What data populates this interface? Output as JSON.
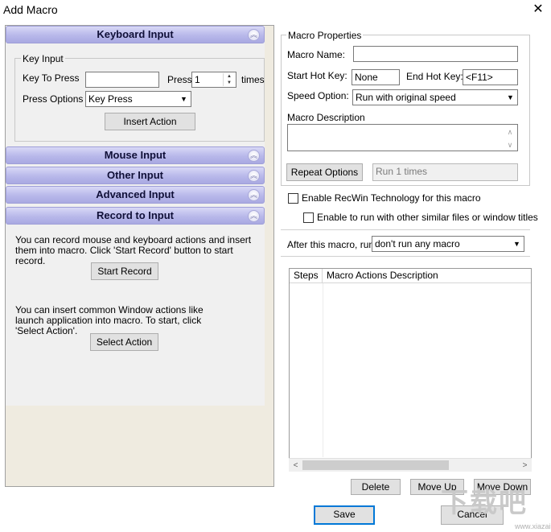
{
  "window": {
    "title": "Add Macro",
    "close_glyph": "✕"
  },
  "sections": {
    "keyboard_input": "Keyboard Input",
    "mouse_input": "Mouse Input",
    "other_input": "Other Input",
    "advanced_input": "Advanced Input",
    "record_to_input": "Record to Input",
    "toggle_glyph": "︽"
  },
  "key_input": {
    "group_label": "Key Input",
    "key_to_press_label": "Key To Press",
    "key_to_press_value": "",
    "press_label": "Press",
    "press_count": "1",
    "times_label": "times",
    "press_options_label": "Press Options",
    "press_options_value": "Key Press",
    "insert_action_label": "Insert Action"
  },
  "record": {
    "record_text": "You can record mouse and keyboard actions and insert them into macro. Click 'Start Record' button to start record.",
    "start_record_label": "Start Record",
    "select_text": "You can insert common Window actions like launch application into macro. To start, click 'Select Action'.",
    "select_action_label": "Select Action"
  },
  "macro_properties": {
    "group_label": "Macro Properties",
    "macro_name_label": "Macro Name:",
    "macro_name_value": "",
    "start_hot_key_label": "Start Hot Key:",
    "start_hot_key_value": "None",
    "end_hot_key_label": "End Hot Key:",
    "end_hot_key_value": "<F11>",
    "speed_option_label": "Speed Option:",
    "speed_option_value": "Run with original speed",
    "description_label": "Macro Description",
    "description_value": "",
    "repeat_options_label": "Repeat Options",
    "repeat_value": "Run 1 times",
    "recwin_label": "Enable RecWin Technology for this macro",
    "similar_files_label": "Enable to run with other similar files or window titles",
    "after_label": "After this macro, run",
    "after_value": "don't run any macro"
  },
  "actions_grid": {
    "columns": [
      "Steps",
      "Macro Actions Description"
    ],
    "rows": []
  },
  "buttons": {
    "delete": "Delete",
    "move_up": "Move Up",
    "move_down": "Move Down",
    "save": "Save",
    "cancel": "Cancel"
  },
  "watermark": {
    "main": "下载吧",
    "sub": "www.xiazaiba.com"
  }
}
